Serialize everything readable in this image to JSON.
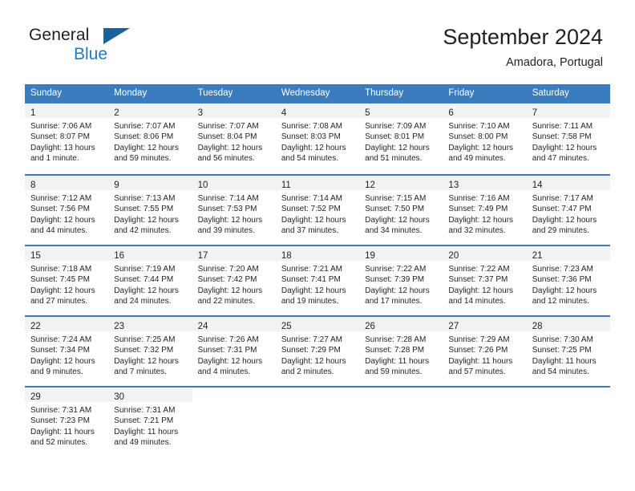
{
  "brand": {
    "word1": "General",
    "word2": "Blue",
    "flag_icon": "triangle-flag-icon",
    "accent_color": "#1f7ac4"
  },
  "header": {
    "title": "September 2024",
    "subtitle": "Amadora, Portugal"
  },
  "theme": {
    "header_blue": "#3a7cbe",
    "daynum_band": "#f2f2f2",
    "text": "#231f20"
  },
  "weekdays": [
    "Sunday",
    "Monday",
    "Tuesday",
    "Wednesday",
    "Thursday",
    "Friday",
    "Saturday"
  ],
  "weeks": [
    [
      {
        "day": "1",
        "sunrise": "Sunrise: 7:06 AM",
        "sunset": "Sunset: 8:07 PM",
        "daylight1": "Daylight: 13 hours",
        "daylight2": "and 1 minute."
      },
      {
        "day": "2",
        "sunrise": "Sunrise: 7:07 AM",
        "sunset": "Sunset: 8:06 PM",
        "daylight1": "Daylight: 12 hours",
        "daylight2": "and 59 minutes."
      },
      {
        "day": "3",
        "sunrise": "Sunrise: 7:07 AM",
        "sunset": "Sunset: 8:04 PM",
        "daylight1": "Daylight: 12 hours",
        "daylight2": "and 56 minutes."
      },
      {
        "day": "4",
        "sunrise": "Sunrise: 7:08 AM",
        "sunset": "Sunset: 8:03 PM",
        "daylight1": "Daylight: 12 hours",
        "daylight2": "and 54 minutes."
      },
      {
        "day": "5",
        "sunrise": "Sunrise: 7:09 AM",
        "sunset": "Sunset: 8:01 PM",
        "daylight1": "Daylight: 12 hours",
        "daylight2": "and 51 minutes."
      },
      {
        "day": "6",
        "sunrise": "Sunrise: 7:10 AM",
        "sunset": "Sunset: 8:00 PM",
        "daylight1": "Daylight: 12 hours",
        "daylight2": "and 49 minutes."
      },
      {
        "day": "7",
        "sunrise": "Sunrise: 7:11 AM",
        "sunset": "Sunset: 7:58 PM",
        "daylight1": "Daylight: 12 hours",
        "daylight2": "and 47 minutes."
      }
    ],
    [
      {
        "day": "8",
        "sunrise": "Sunrise: 7:12 AM",
        "sunset": "Sunset: 7:56 PM",
        "daylight1": "Daylight: 12 hours",
        "daylight2": "and 44 minutes."
      },
      {
        "day": "9",
        "sunrise": "Sunrise: 7:13 AM",
        "sunset": "Sunset: 7:55 PM",
        "daylight1": "Daylight: 12 hours",
        "daylight2": "and 42 minutes."
      },
      {
        "day": "10",
        "sunrise": "Sunrise: 7:14 AM",
        "sunset": "Sunset: 7:53 PM",
        "daylight1": "Daylight: 12 hours",
        "daylight2": "and 39 minutes."
      },
      {
        "day": "11",
        "sunrise": "Sunrise: 7:14 AM",
        "sunset": "Sunset: 7:52 PM",
        "daylight1": "Daylight: 12 hours",
        "daylight2": "and 37 minutes."
      },
      {
        "day": "12",
        "sunrise": "Sunrise: 7:15 AM",
        "sunset": "Sunset: 7:50 PM",
        "daylight1": "Daylight: 12 hours",
        "daylight2": "and 34 minutes."
      },
      {
        "day": "13",
        "sunrise": "Sunrise: 7:16 AM",
        "sunset": "Sunset: 7:49 PM",
        "daylight1": "Daylight: 12 hours",
        "daylight2": "and 32 minutes."
      },
      {
        "day": "14",
        "sunrise": "Sunrise: 7:17 AM",
        "sunset": "Sunset: 7:47 PM",
        "daylight1": "Daylight: 12 hours",
        "daylight2": "and 29 minutes."
      }
    ],
    [
      {
        "day": "15",
        "sunrise": "Sunrise: 7:18 AM",
        "sunset": "Sunset: 7:45 PM",
        "daylight1": "Daylight: 12 hours",
        "daylight2": "and 27 minutes."
      },
      {
        "day": "16",
        "sunrise": "Sunrise: 7:19 AM",
        "sunset": "Sunset: 7:44 PM",
        "daylight1": "Daylight: 12 hours",
        "daylight2": "and 24 minutes."
      },
      {
        "day": "17",
        "sunrise": "Sunrise: 7:20 AM",
        "sunset": "Sunset: 7:42 PM",
        "daylight1": "Daylight: 12 hours",
        "daylight2": "and 22 minutes."
      },
      {
        "day": "18",
        "sunrise": "Sunrise: 7:21 AM",
        "sunset": "Sunset: 7:41 PM",
        "daylight1": "Daylight: 12 hours",
        "daylight2": "and 19 minutes."
      },
      {
        "day": "19",
        "sunrise": "Sunrise: 7:22 AM",
        "sunset": "Sunset: 7:39 PM",
        "daylight1": "Daylight: 12 hours",
        "daylight2": "and 17 minutes."
      },
      {
        "day": "20",
        "sunrise": "Sunrise: 7:22 AM",
        "sunset": "Sunset: 7:37 PM",
        "daylight1": "Daylight: 12 hours",
        "daylight2": "and 14 minutes."
      },
      {
        "day": "21",
        "sunrise": "Sunrise: 7:23 AM",
        "sunset": "Sunset: 7:36 PM",
        "daylight1": "Daylight: 12 hours",
        "daylight2": "and 12 minutes."
      }
    ],
    [
      {
        "day": "22",
        "sunrise": "Sunrise: 7:24 AM",
        "sunset": "Sunset: 7:34 PM",
        "daylight1": "Daylight: 12 hours",
        "daylight2": "and 9 minutes."
      },
      {
        "day": "23",
        "sunrise": "Sunrise: 7:25 AM",
        "sunset": "Sunset: 7:32 PM",
        "daylight1": "Daylight: 12 hours",
        "daylight2": "and 7 minutes."
      },
      {
        "day": "24",
        "sunrise": "Sunrise: 7:26 AM",
        "sunset": "Sunset: 7:31 PM",
        "daylight1": "Daylight: 12 hours",
        "daylight2": "and 4 minutes."
      },
      {
        "day": "25",
        "sunrise": "Sunrise: 7:27 AM",
        "sunset": "Sunset: 7:29 PM",
        "daylight1": "Daylight: 12 hours",
        "daylight2": "and 2 minutes."
      },
      {
        "day": "26",
        "sunrise": "Sunrise: 7:28 AM",
        "sunset": "Sunset: 7:28 PM",
        "daylight1": "Daylight: 11 hours",
        "daylight2": "and 59 minutes."
      },
      {
        "day": "27",
        "sunrise": "Sunrise: 7:29 AM",
        "sunset": "Sunset: 7:26 PM",
        "daylight1": "Daylight: 11 hours",
        "daylight2": "and 57 minutes."
      },
      {
        "day": "28",
        "sunrise": "Sunrise: 7:30 AM",
        "sunset": "Sunset: 7:25 PM",
        "daylight1": "Daylight: 11 hours",
        "daylight2": "and 54 minutes."
      }
    ],
    [
      {
        "day": "29",
        "sunrise": "Sunrise: 7:31 AM",
        "sunset": "Sunset: 7:23 PM",
        "daylight1": "Daylight: 11 hours",
        "daylight2": "and 52 minutes."
      },
      {
        "day": "30",
        "sunrise": "Sunrise: 7:31 AM",
        "sunset": "Sunset: 7:21 PM",
        "daylight1": "Daylight: 11 hours",
        "daylight2": "and 49 minutes."
      },
      {
        "day": "",
        "sunrise": "",
        "sunset": "",
        "daylight1": "",
        "daylight2": ""
      },
      {
        "day": "",
        "sunrise": "",
        "sunset": "",
        "daylight1": "",
        "daylight2": ""
      },
      {
        "day": "",
        "sunrise": "",
        "sunset": "",
        "daylight1": "",
        "daylight2": ""
      },
      {
        "day": "",
        "sunrise": "",
        "sunset": "",
        "daylight1": "",
        "daylight2": ""
      },
      {
        "day": "",
        "sunrise": "",
        "sunset": "",
        "daylight1": "",
        "daylight2": ""
      }
    ]
  ]
}
